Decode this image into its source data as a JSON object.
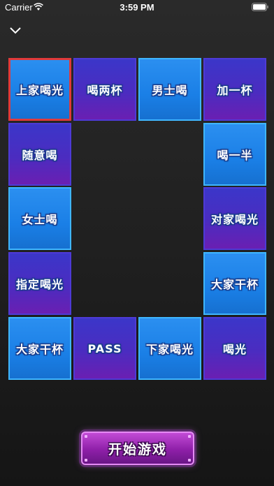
{
  "status_bar": {
    "carrier": "Carrier",
    "time": "3:59 PM"
  },
  "nav": {
    "collapse_icon": "chevron-down-icon"
  },
  "board": {
    "tiles": [
      {
        "label": "上家喝光",
        "color": "blue",
        "selected": true
      },
      {
        "label": "喝两杯",
        "color": "purple",
        "selected": false
      },
      {
        "label": "男士喝",
        "color": "blue",
        "selected": false
      },
      {
        "label": "加一杯",
        "color": "purple",
        "selected": false
      },
      {
        "label": "随意喝",
        "color": "purple",
        "selected": false
      },
      {
        "label": "喝一半",
        "color": "blue",
        "selected": false
      },
      {
        "label": "女士喝",
        "color": "blue",
        "selected": false
      },
      {
        "label": "对家喝光",
        "color": "purple",
        "selected": false
      },
      {
        "label": "指定喝光",
        "color": "purple",
        "selected": false
      },
      {
        "label": "大家干杯",
        "color": "blue",
        "selected": false
      },
      {
        "label": "大家干杯",
        "color": "blue",
        "selected": false
      },
      {
        "label": "PASS",
        "color": "purple",
        "selected": false
      },
      {
        "label": "下家喝光",
        "color": "blue",
        "selected": false
      },
      {
        "label": "喝光",
        "color": "purple",
        "selected": false
      }
    ]
  },
  "start_button": {
    "label": "开始游戏"
  },
  "colors": {
    "tile_blue": "#1a7fe6",
    "tile_purple": "#4b2cc0",
    "selected_outline": "#e03a3a",
    "start_button": "#8e1fa8"
  }
}
